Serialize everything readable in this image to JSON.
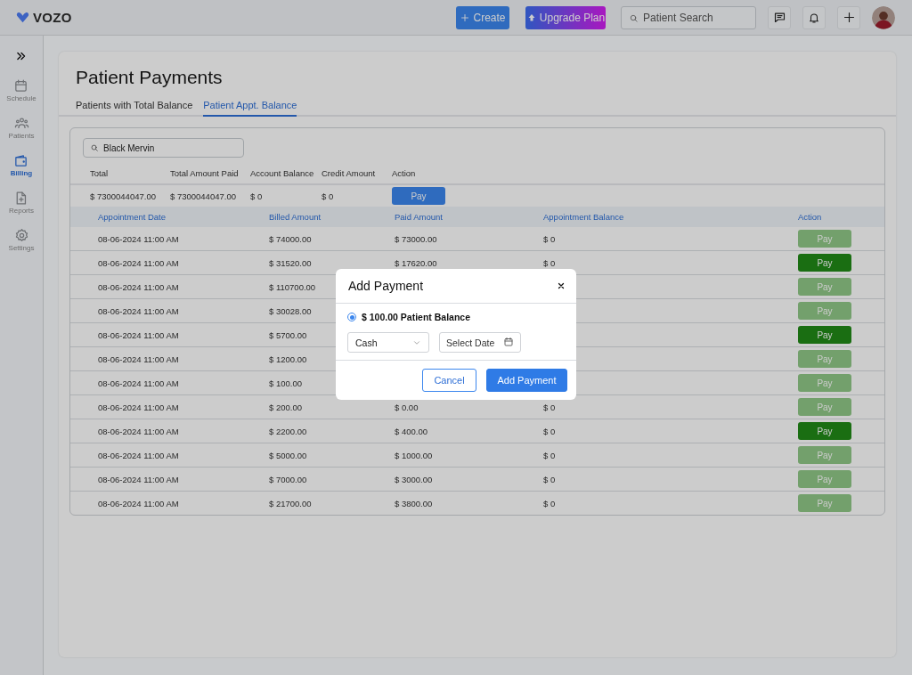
{
  "app": {
    "logo": "VOZO"
  },
  "topbar": {
    "create": "Create",
    "upgrade": "Upgrade Plan",
    "search": {
      "placeholder": "Patient Search"
    }
  },
  "sidebar": {
    "items": [
      {
        "label": "Schedule",
        "kind": "calendar",
        "selected": false
      },
      {
        "label": "Patients",
        "kind": "people",
        "selected": false
      },
      {
        "label": "Billing",
        "kind": "wallet",
        "selected": true
      },
      {
        "label": "Reports",
        "kind": "report",
        "selected": false
      },
      {
        "label": "Settings",
        "kind": "gear",
        "selected": false
      }
    ]
  },
  "page": {
    "title": "Patient Payments",
    "tabs": [
      {
        "label": "Patients with Total Balance",
        "selected": false
      },
      {
        "label": "Patient Appt. Balance",
        "selected": true
      }
    ]
  },
  "filter": {
    "value": "Black Mervin"
  },
  "summary": {
    "columns": [
      "Total",
      "Total Amount Paid",
      "Account Balance",
      "Credit Amount",
      "Action"
    ],
    "row": [
      "$ 7300044047.00",
      "$ 7300044047.00",
      "$ 0",
      "$ 0"
    ],
    "action": "Pay"
  },
  "appointments": {
    "columns": [
      "Appointment Date",
      "Billed Amount",
      "Paid Amount",
      "Appointment Balance",
      "Action"
    ],
    "rows": [
      {
        "date": "08-06-2024 11:00 AM",
        "billed": "$ 74000.00",
        "paid": "$ 73000.00",
        "balance": "$ 0",
        "action": "Pay",
        "disabled": true
      },
      {
        "date": "08-06-2024 11:00 AM",
        "billed": "$ 31520.00",
        "paid": "$ 17620.00",
        "balance": "$ 0",
        "action": "Pay",
        "disabled": false
      },
      {
        "date": "08-06-2024 11:00 AM",
        "billed": "$ 110700.00",
        "action": "Pay",
        "disabled": true
      },
      {
        "date": "08-06-2024 11:00 AM",
        "billed": "$ 30028.00",
        "action": "Pay",
        "disabled": true
      },
      {
        "date": "08-06-2024 11:00 AM",
        "billed": "$ 5700.00",
        "action": "Pay",
        "disabled": false
      },
      {
        "date": "08-06-2024 11:00 AM",
        "billed": "$ 1200.00",
        "action": "Pay",
        "disabled": true
      },
      {
        "date": "08-06-2024 11:00 AM",
        "billed": "$ 100.00",
        "action": "Pay",
        "disabled": true
      },
      {
        "date": "08-06-2024 11:00 AM",
        "billed": "$ 200.00",
        "paid": "$ 0.00",
        "balance": "$ 0",
        "action": "Pay",
        "disabled": true
      },
      {
        "date": "08-06-2024 11:00 AM",
        "billed": "$ 2200.00",
        "paid": "$ 400.00",
        "balance": "$ 0",
        "action": "Pay",
        "disabled": false
      },
      {
        "date": "08-06-2024 11:00 AM",
        "billed": "$ 5000.00",
        "paid": "$ 1000.00",
        "balance": "$ 0",
        "action": "Pay",
        "disabled": true
      },
      {
        "date": "08-06-2024 11:00 AM",
        "billed": "$ 7000.00",
        "paid": "$ 3000.00",
        "balance": "$ 0",
        "action": "Pay",
        "disabled": true
      },
      {
        "date": "08-06-2024 11:00 AM",
        "billed": "$ 21700.00",
        "paid": "$ 3800.00",
        "balance": "$ 0",
        "action": "Pay",
        "disabled": true
      }
    ]
  },
  "dialog": {
    "title": "Add Payment",
    "option": {
      "label": "$ 100.00 Patient Balance",
      "selected": true
    },
    "method": "Cash",
    "date": {
      "placeholder": "Select Date"
    },
    "buttons": [
      {
        "label": "Cancel",
        "kind": "secondary"
      },
      {
        "label": "Add Payment",
        "kind": "primary"
      }
    ]
  }
}
